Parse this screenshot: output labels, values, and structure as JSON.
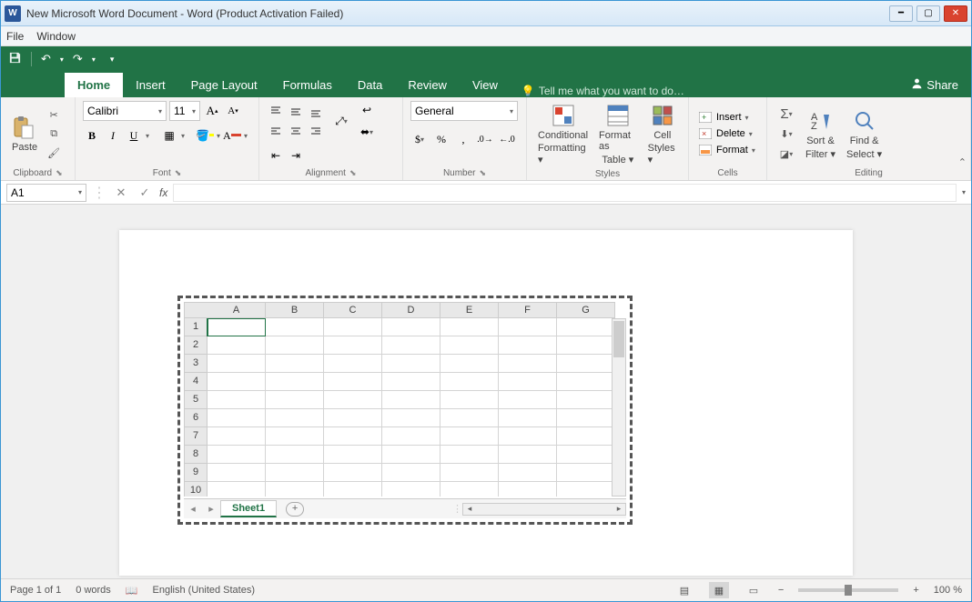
{
  "window": {
    "title": "New Microsoft Word Document - Word (Product Activation Failed)",
    "app_badge": "W"
  },
  "menubar": {
    "file": "File",
    "window": "Window"
  },
  "qat": {
    "save": "💾",
    "undo": "↶",
    "redo": "↷"
  },
  "tabs": {
    "home": "Home",
    "insert": "Insert",
    "page_layout": "Page Layout",
    "formulas": "Formulas",
    "data": "Data",
    "review": "Review",
    "view": "View",
    "tell_me": "Tell me what you want to do…",
    "share": "Share"
  },
  "ribbon": {
    "clipboard": {
      "paste": "Paste",
      "label": "Clipboard"
    },
    "font": {
      "name": "Calibri",
      "size": "11",
      "bold": "B",
      "italic": "I",
      "underline": "U",
      "label": "Font"
    },
    "alignment": {
      "label": "Alignment"
    },
    "number": {
      "format": "General",
      "label": "Number"
    },
    "styles": {
      "conditional": "Conditional Formatting",
      "format_as_table": "Format as Table",
      "cell_styles": "Cell Styles",
      "cond_l1": "Conditional",
      "cond_l2": "Formatting ▾",
      "tbl_l1": "Format as",
      "tbl_l2": "Table ▾",
      "cell_l1": "Cell",
      "cell_l2": "Styles ▾",
      "label": "Styles"
    },
    "cells": {
      "insert": "Insert",
      "delete": "Delete",
      "format": "Format",
      "label": "Cells"
    },
    "editing": {
      "sort_l1": "Sort &",
      "sort_l2": "Filter ▾",
      "find_l1": "Find &",
      "find_l2": "Select ▾",
      "label": "Editing"
    }
  },
  "formula_bar": {
    "name_box": "A1",
    "fx": "fx"
  },
  "sheet": {
    "columns": [
      "A",
      "B",
      "C",
      "D",
      "E",
      "F",
      "G"
    ],
    "rows": [
      "1",
      "2",
      "3",
      "4",
      "5",
      "6",
      "7",
      "8",
      "9",
      "10"
    ],
    "tab": "Sheet1",
    "add": "+"
  },
  "statusbar": {
    "page": "Page 1 of 1",
    "words": "0 words",
    "language": "English (United States)",
    "zoom": "100 %",
    "minus": "−",
    "plus": "+"
  }
}
